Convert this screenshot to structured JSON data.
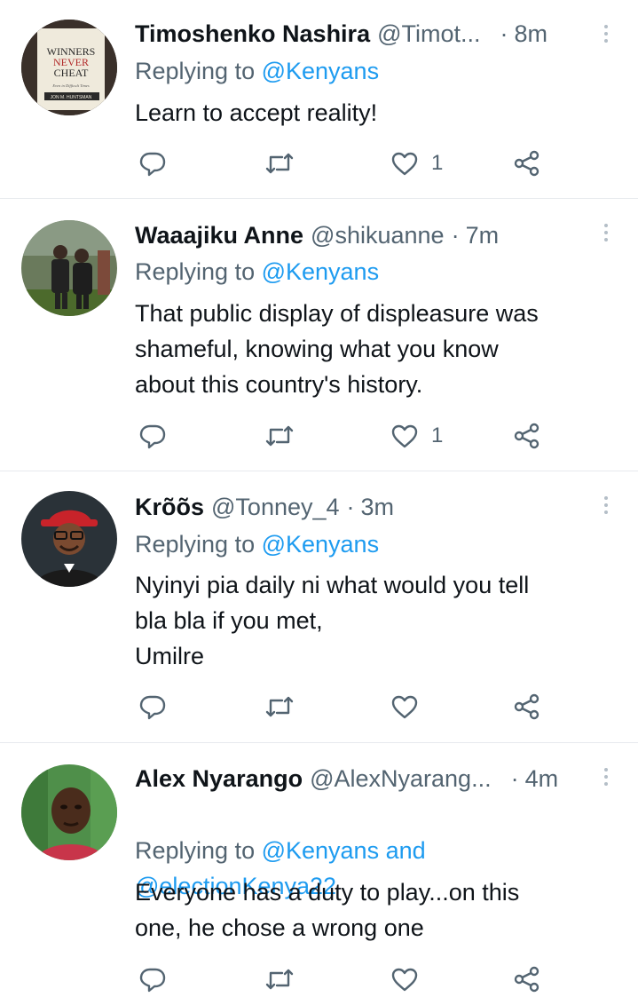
{
  "replies": [
    {
      "name": "Timoshenko Nashira",
      "handle": "@Timot...",
      "separator": "·",
      "time": "8m",
      "replying_prefix": "Replying to ",
      "replying_to": "@Kenyans",
      "text": "Learn to accept reality!",
      "likes": "1",
      "avatar_book": {
        "line1": "WINNERS",
        "line2": "NEVER",
        "line3": "CHEAT",
        "subtitle": "Even in Difficult Times",
        "author": "JON M. HUNTSMAN"
      }
    },
    {
      "name": "Waaajiku Anne",
      "handle": "@shikuanne",
      "separator": "·",
      "time": "7m",
      "replying_prefix": "Replying to ",
      "replying_to": "@Kenyans",
      "text": "That public display of displeasure was\nshameful, knowing what you know\nabout this country's history.",
      "likes": "1"
    },
    {
      "name": "Krõõs",
      "handle": "@Tonney_4",
      "separator": "·",
      "time": "3m",
      "replying_prefix": "Replying to ",
      "replying_to": "@Kenyans",
      "text": "Nyinyi pia daily ni what would you tell\nbla bla if you met,\nUmilre",
      "likes": ""
    },
    {
      "name": "Alex Nyarango",
      "handle": "@AlexNyarang...",
      "separator": "·",
      "time": "4m",
      "replying_prefix": "Replying to ",
      "replying_to": "@Kenyans and\n@electionKenya22",
      "text": "Everyone has a duty to play...on this\none, he chose a wrong one",
      "likes": ""
    }
  ],
  "icons": {
    "reply": "reply-icon",
    "retweet": "retweet-icon",
    "like": "heart-icon",
    "share": "share-icon",
    "more": "more-vertical-icon"
  },
  "colors": {
    "link": "#1d9bf0",
    "secondary_text": "#536471",
    "divider": "#e7eaee"
  }
}
